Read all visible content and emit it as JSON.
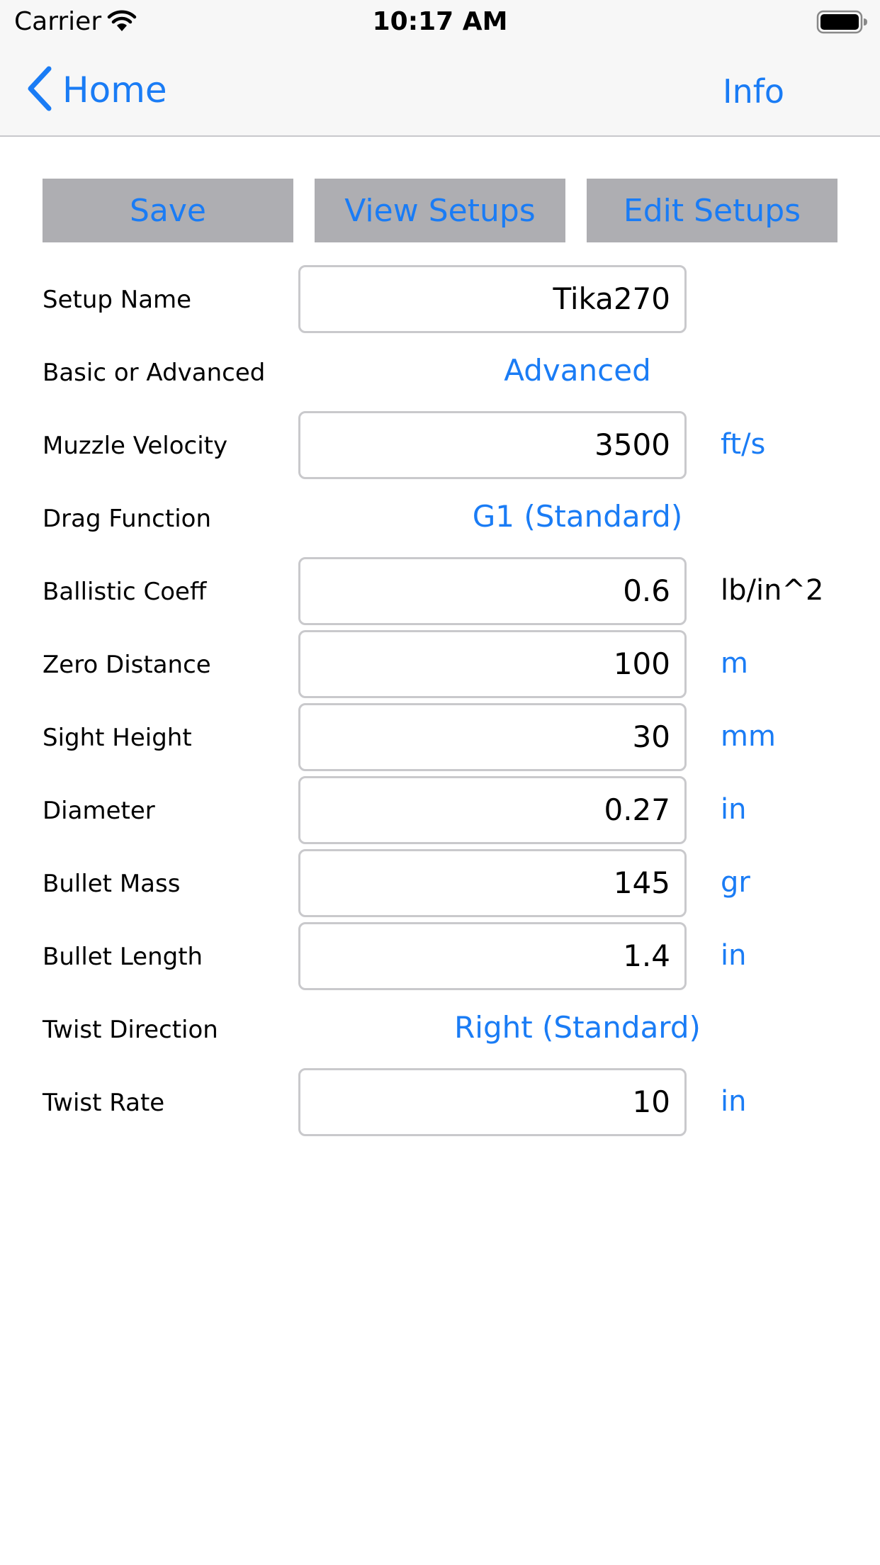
{
  "status": {
    "carrier": "Carrier",
    "time": "10:17 AM"
  },
  "nav": {
    "back_label": "Home",
    "info_label": "Info"
  },
  "toolbar": {
    "save": "Save",
    "view": "View Setups",
    "edit": "Edit Setups"
  },
  "labels": {
    "setup_name": "Setup Name",
    "basic_advanced": "Basic or Advanced",
    "muzzle_velocity": "Muzzle Velocity",
    "drag_function": "Drag Function",
    "ballistic_coeff": "Ballistic Coeff",
    "zero_distance": "Zero Distance",
    "sight_height": "Sight Height",
    "diameter": "Diameter",
    "bullet_mass": "Bullet Mass",
    "bullet_length": "Bullet Length",
    "twist_direction": "Twist Direction",
    "twist_rate": "Twist Rate"
  },
  "values": {
    "setup_name": "Tika270",
    "basic_advanced": "Advanced",
    "muzzle_velocity": "3500",
    "drag_function": "G1 (Standard)",
    "ballistic_coeff": "0.6",
    "zero_distance": "100",
    "sight_height": "30",
    "diameter": "0.27",
    "bullet_mass": "145",
    "bullet_length": "1.4",
    "twist_direction": "Right (Standard)",
    "twist_rate": "10"
  },
  "units": {
    "muzzle_velocity": "ft/s",
    "ballistic_coeff": "lb/in^2",
    "zero_distance": "m",
    "sight_height": "mm",
    "diameter": "in",
    "bullet_mass": "gr",
    "bullet_length": "in",
    "twist_rate": "in"
  },
  "colors": {
    "accent": "#1a7cf5",
    "button_bg": "#aeaeb2",
    "bar_bg": "#f7f7f7"
  },
  "icons": {
    "back": "chevron-left-icon",
    "wifi": "wifi-icon",
    "battery": "battery-icon"
  }
}
